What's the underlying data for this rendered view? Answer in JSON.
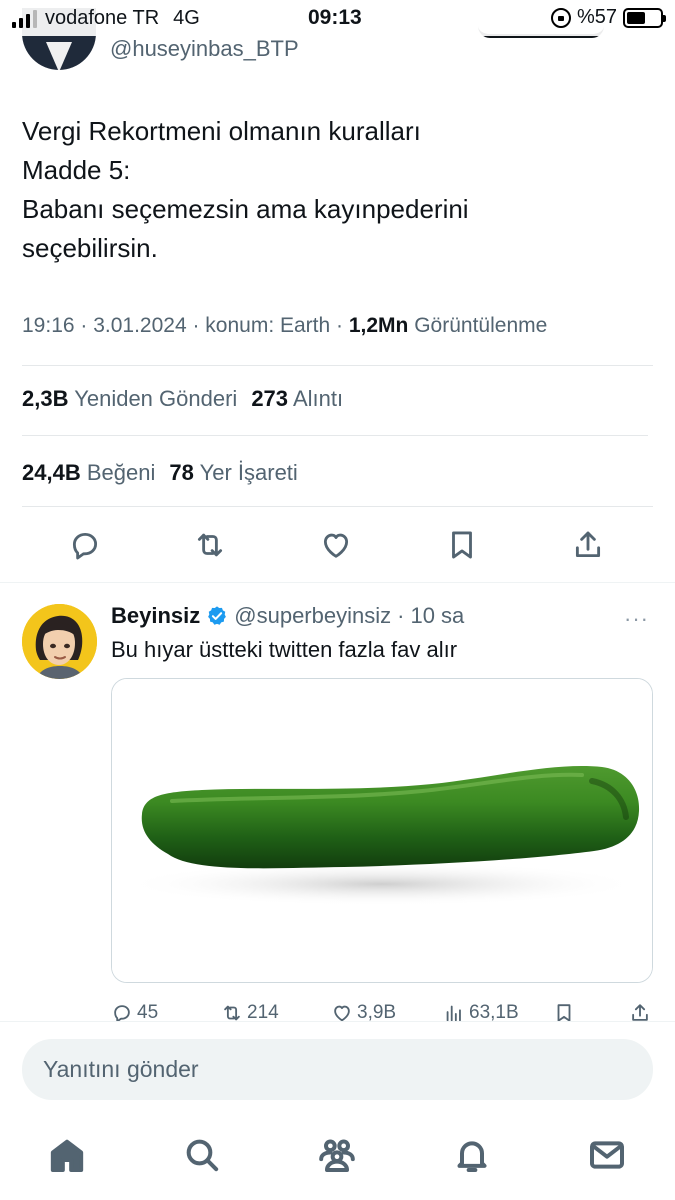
{
  "status_bar": {
    "carrier": "vodafone TR",
    "network": "4G",
    "time": "09:13",
    "battery": "%57",
    "battery_level": 0.57,
    "signal_bars": 3
  },
  "tweet": {
    "handle": "@huseyinbas_BTP",
    "text_lines": [
      "Vergi Rekortmeni olmanın kuralları",
      "Madde 5:",
      "Babanı seçemezsin ama kayınpederini",
      "seçebilirsin."
    ],
    "meta_prefix": "19:16 · 3.01.2024 · konum: Earth · ",
    "views_count": "1,2Mn",
    "views_label": "Görüntülenme",
    "reposts_count": "2,3B",
    "reposts_label": "Yeniden Gönderi",
    "quotes_count": "273",
    "quotes_label": "Alıntı",
    "likes_count": "24,4B",
    "likes_label": "Beğeni",
    "bookmarks_count": "78",
    "bookmarks_label": "Yer İşareti"
  },
  "reply": {
    "name": "Beyinsiz",
    "handle": "@superbeyinsiz",
    "separator": "·",
    "time": "10 sa",
    "more": "···",
    "text": "Bu hıyar üstteki twitten fazla fav alır",
    "stats": {
      "replies": "45",
      "reposts": "214",
      "likes": "3,9B",
      "views": "63,1B"
    }
  },
  "composer": {
    "placeholder": "Yanıtını gönder"
  },
  "colors": {
    "text": "#0f1419",
    "secondary": "#536471",
    "divider": "#e5e8ea",
    "verified": "#1d9bf0",
    "composer_bg": "#eff3f4"
  },
  "icons": {
    "actions": [
      "reply-icon",
      "repost-icon",
      "like-icon",
      "bookmark-icon",
      "share-icon"
    ],
    "nav": [
      "home-icon",
      "search-icon",
      "communities-icon",
      "notifications-icon",
      "messages-icon"
    ]
  }
}
